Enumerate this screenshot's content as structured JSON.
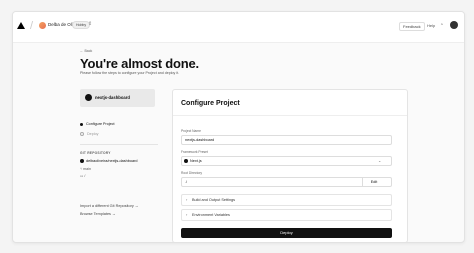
{
  "topbar": {
    "user_name": "Delba de Oliveira",
    "plan_badge": "Hobby",
    "feedback_label": "Feedback",
    "help_label": "Help"
  },
  "main": {
    "back_label": "← Back",
    "heading": "You're almost done.",
    "subheading": "Please follow the steps to configure your Project and deploy it.",
    "repo_name": "nextjs-dashboard",
    "steps": [
      {
        "label": "Configure Project",
        "active": true
      },
      {
        "label": "Deploy",
        "active": false
      }
    ],
    "git": {
      "section_label": "GIT REPOSITORY",
      "repo_path": "delbaoliveira/nextjs-dashboard",
      "branch": "main",
      "folder": "/"
    },
    "import_link": "Import a different Git Repository →",
    "browse_link": "Browse Templates →"
  },
  "panel": {
    "title": "Configure Project",
    "project_name_label": "Project Name",
    "project_name_value": "nextjs-dashboard",
    "framework_label": "Framework Preset",
    "framework_value": "Next.js",
    "root_dir_label": "Root Directory",
    "root_dir_value": "./",
    "edit_label": "Edit",
    "build_settings_label": "Build and Output Settings",
    "env_vars_label": "Environment Variables",
    "deploy_label": "Deploy"
  },
  "icons": {
    "logo": "vercel-triangle-icon",
    "repo": "github-icon",
    "branch": "git-branch-icon",
    "folder": "folder-icon",
    "framework": "nextjs-icon"
  },
  "colors": {
    "primary": "#111111",
    "background": "#fafafa"
  }
}
